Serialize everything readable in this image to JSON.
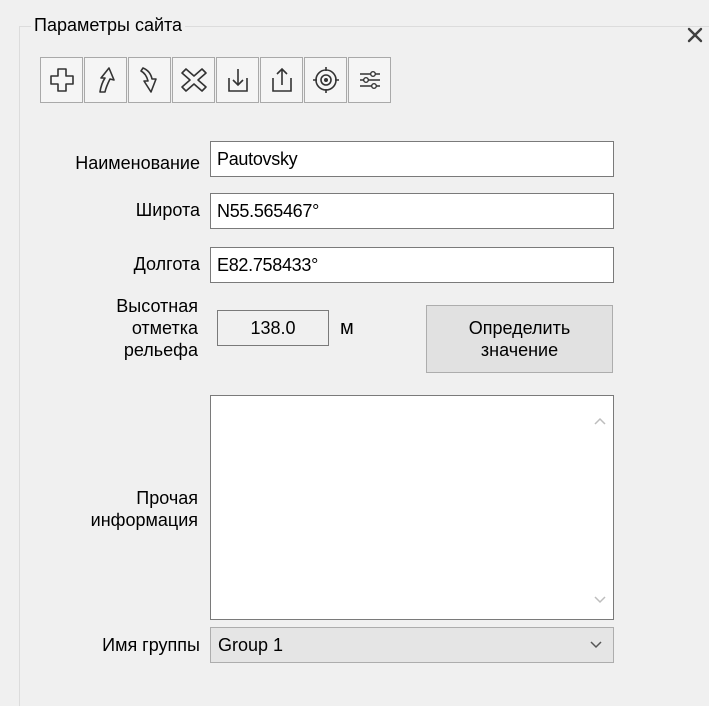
{
  "panel": {
    "title": "Параметры сайта",
    "close_icon": "close-icon"
  },
  "toolbar": {
    "buttons": [
      {
        "icon": "add-icon"
      },
      {
        "icon": "move-up-icon"
      },
      {
        "icon": "move-down-icon"
      },
      {
        "icon": "delete-icon"
      },
      {
        "icon": "import-icon"
      },
      {
        "icon": "export-icon"
      },
      {
        "icon": "target-icon"
      },
      {
        "icon": "settings-sliders-icon"
      }
    ]
  },
  "form": {
    "name_label": "Наименование",
    "name_value": "Pautovsky",
    "latitude_label": "Широта",
    "latitude_value": "N55.565467°",
    "longitude_label": "Долгота",
    "longitude_value": "E82.758433°",
    "elevation_label_line1": "Высотная",
    "elevation_label_line2": "отметка",
    "elevation_label_line3": "рельефа",
    "elevation_value": "138.0",
    "elevation_unit": "м",
    "determine_button_line1": "Определить",
    "determine_button_line2": "значение",
    "other_info_label_line1": "Прочая",
    "other_info_label_line2": "информация",
    "other_info_value": "",
    "group_label": "Имя группы",
    "group_value": "Group 1"
  }
}
